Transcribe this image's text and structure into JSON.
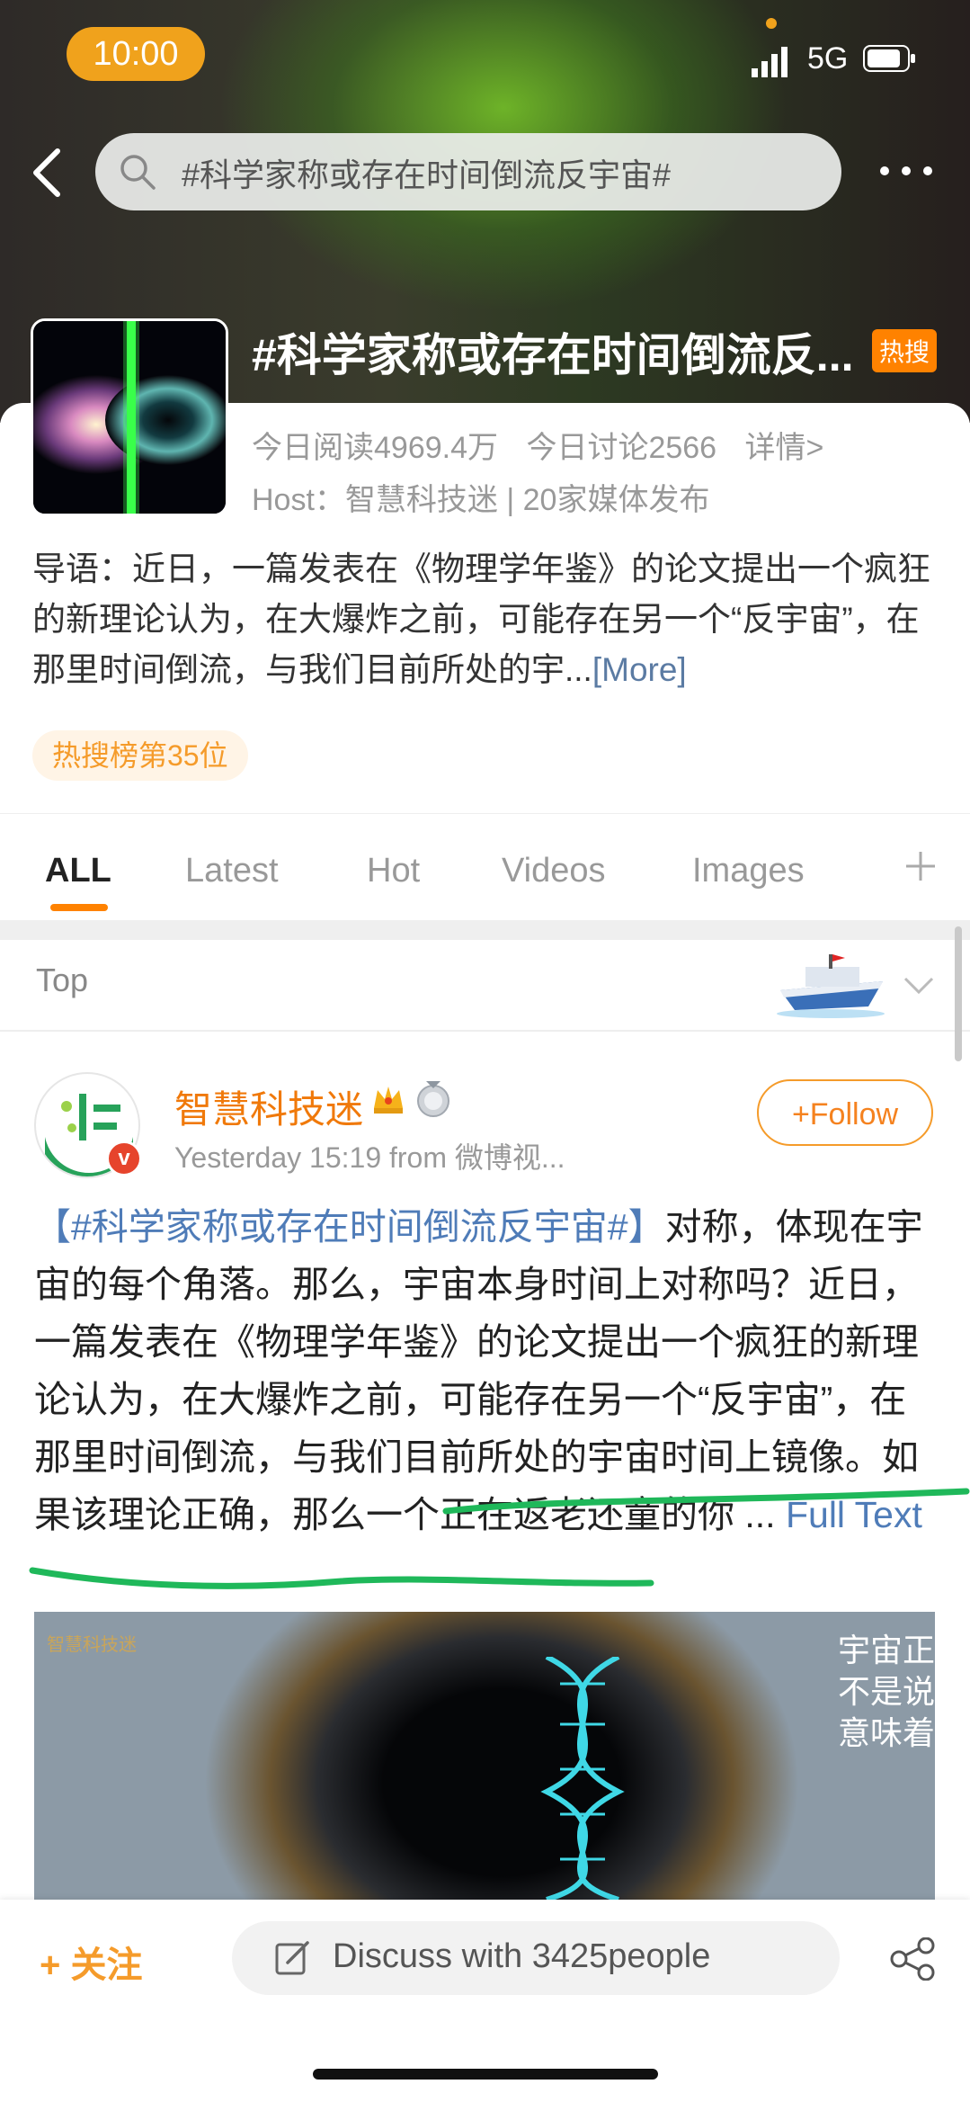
{
  "status_bar": {
    "time": "10:00",
    "network": "5G"
  },
  "search": {
    "query": "#科学家称或存在时间倒流反宇宙#"
  },
  "topic": {
    "title": "#科学家称或存在时间倒流反...",
    "hot_badge": "热搜",
    "reads_today": "今日阅读4969.4万",
    "discussions_today": "今日讨论2566",
    "details_link": "详情>",
    "host_line": "Host：智慧科技迷 | 20家媒体发布",
    "intro": "导语：近日，一篇发表在《物理学年鉴》的论文提出一个疯狂的新理论认为，在大爆炸之前，可能存在另一个“反宇宙”，在那里时间倒流，与我们目前所处的宇...",
    "more_link": "[More]",
    "rank": "热搜榜第35位"
  },
  "tabs": [
    {
      "label": "ALL",
      "active": true
    },
    {
      "label": "Latest"
    },
    {
      "label": "Hot"
    },
    {
      "label": "Videos"
    },
    {
      "label": "Images"
    }
  ],
  "section_label": "Top",
  "post": {
    "author": "智慧科技迷",
    "verified_mark": "v",
    "meta": "Yesterday 15:19  from 微博视...",
    "follow_label": "+Follow",
    "hashtag": "【#科学家称或存在时间倒流反宇宙#】",
    "body": "对称，体现在宇宙的每个角落。那么，宇宙本身时间上对称吗？近日，一篇发表在《物理学年鉴》的论文提出一个疯狂的新理论认为，在大爆炸之前，可能存在另一个“反宇宙”，在那里时间倒流，与我们目前所处的宇宙时间上镜像。如果该理论正确，那么一个正在返老还童的你 ... ",
    "full_text_link": "Full Text",
    "media_logo": "智慧科技迷",
    "media_caption": "宇宙正 不是说 意味着"
  },
  "bottom_bar": {
    "follow_label": "+ 关注",
    "discuss_label": "Discuss with 3425people"
  },
  "colors": {
    "accent": "#ff8200",
    "link": "#4f7cb8",
    "annotation": "#1fb85a"
  }
}
